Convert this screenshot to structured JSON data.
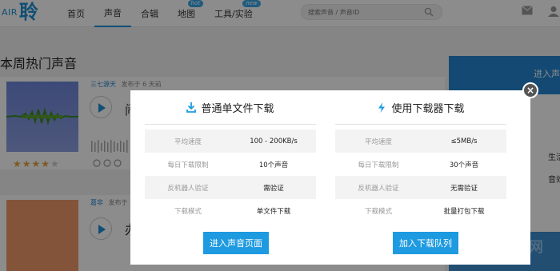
{
  "nav": {
    "logo_text": "AIR",
    "logo_char": "聆",
    "items": [
      {
        "label": "首页"
      },
      {
        "label": "声音"
      },
      {
        "label": "合辑"
      },
      {
        "label": "地图",
        "badge": "hot"
      },
      {
        "label": "工具/实验",
        "badge": "new"
      }
    ],
    "search_placeholder": "搜索声音 / 声音ID"
  },
  "page": {
    "section_title": "本周热门声音",
    "right_panel_label": "进入声",
    "right_lines": [
      "生活",
      "音效"
    ],
    "right_bottom_text": "网"
  },
  "cards": [
    {
      "author": "三七源天",
      "published": "发布于 6 天前",
      "title": "闹",
      "stars": "★★★★",
      "stars_off": "★"
    },
    {
      "author": "葛非",
      "published": "发布于 7",
      "title": "办"
    }
  ],
  "modal": {
    "left": {
      "title": "普通单文件下载",
      "rows": [
        {
          "k": "平均速度",
          "v": "100 - 200KB/s"
        },
        {
          "k": "每日下载限制",
          "v": "10个声音"
        },
        {
          "k": "反机器人验证",
          "v": "需验证"
        },
        {
          "k": "下载模式",
          "v": "单文件下载"
        }
      ],
      "button": "进入声音页面"
    },
    "right": {
      "title": "使用下载器下载",
      "rows": [
        {
          "k": "平均速度",
          "v": "≤5MB/s"
        },
        {
          "k": "每日下载限制",
          "v": "30个声音"
        },
        {
          "k": "反机器人验证",
          "v": "无需验证"
        },
        {
          "k": "下载模式",
          "v": "批量打包下载"
        }
      ],
      "button": "加入下载队列"
    },
    "close_symbol": "×"
  },
  "colors": {
    "accent": "#1e9ae0",
    "overlay": "rgba(0,0,0,0.45)"
  }
}
